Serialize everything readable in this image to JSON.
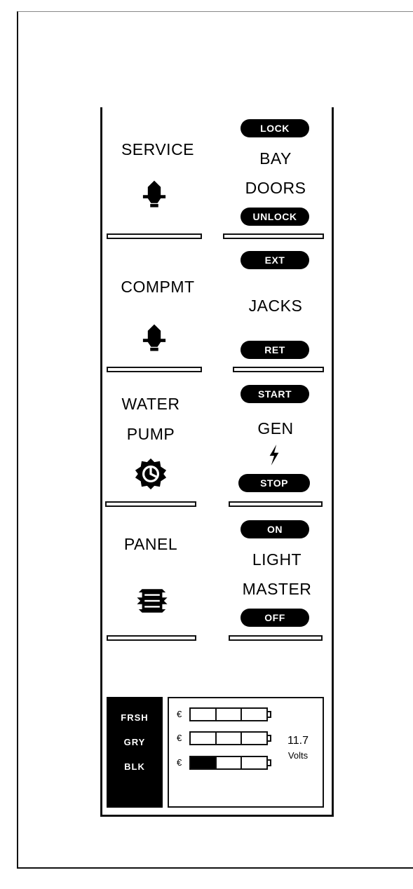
{
  "service": {
    "label": "SERVICE"
  },
  "bay_doors": {
    "lock": "LOCK",
    "line1": "BAY",
    "line2": "DOORS",
    "unlock": "UNLOCK"
  },
  "compmt": {
    "label": "COMPMT"
  },
  "jacks": {
    "ext": "EXT",
    "label": "JACKS",
    "ret": "RET"
  },
  "water_pump": {
    "line1": "WATER",
    "line2": "PUMP"
  },
  "gen": {
    "start": "START",
    "label": "GEN",
    "stop": "STOP"
  },
  "panel": {
    "label": "PANEL"
  },
  "light_master": {
    "on": "ON",
    "line1": "LIGHT",
    "line2": "MASTER",
    "off": "OFF"
  },
  "battery": {
    "sources": [
      "FRSH",
      "GRY",
      "BLK"
    ],
    "levels": [
      0,
      0,
      1
    ],
    "reading": "11.7",
    "unit": "Volts"
  },
  "colors": {
    "ink": "#000000",
    "background": "#ffffff"
  },
  "icons": [
    "service-light-icon",
    "compartment-light-icon",
    "water-pump-icon",
    "generator-bolt-icon",
    "panel-light-icon",
    "battery-icon"
  ]
}
